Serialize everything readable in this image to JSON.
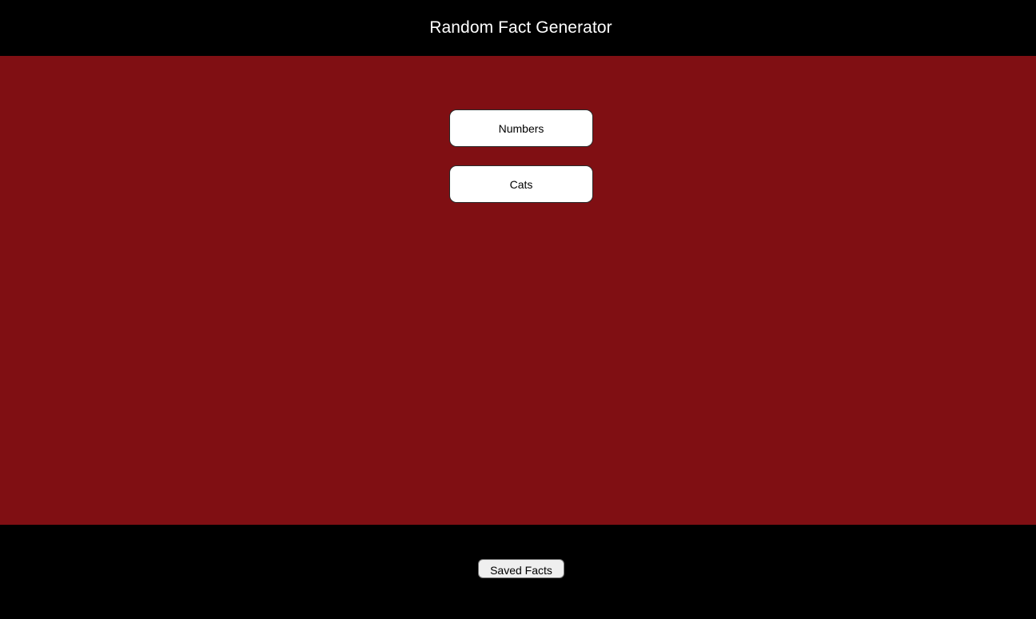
{
  "app": {
    "title": "Random Fact Generator"
  },
  "categories": [
    {
      "label": "Numbers"
    },
    {
      "label": "Cats"
    }
  ],
  "footer": {
    "saved_label": "Saved Facts"
  },
  "colors": {
    "header_bg": "#000000",
    "main_bg": "#800f13",
    "footer_bg": "#000000",
    "button_bg": "#ffffff",
    "text_light": "#ffffff"
  }
}
